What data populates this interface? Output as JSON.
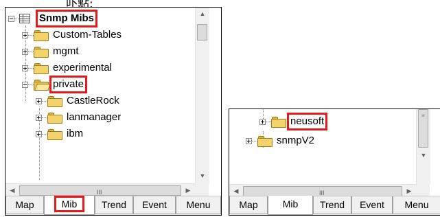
{
  "top_text": "卟點:",
  "left_panel": {
    "tree": [
      {
        "label": "Snmp Mibs",
        "bold": true,
        "icon": "table-icon",
        "expander": "minus",
        "level": 0,
        "highlighted": true
      },
      {
        "label": "Custom-Tables",
        "icon": "folder-icon",
        "expander": "plus",
        "level": 1,
        "highlighted": false
      },
      {
        "label": "mgmt",
        "icon": "folder-icon",
        "expander": "plus",
        "level": 1,
        "highlighted": false
      },
      {
        "label": "experimental",
        "icon": "folder-icon",
        "expander": "plus",
        "level": 1,
        "highlighted": false
      },
      {
        "label": "private",
        "icon": "folder-open-icon",
        "expander": "minus",
        "level": 1,
        "highlighted": true
      },
      {
        "label": "CastleRock",
        "icon": "folder-icon",
        "expander": "plus",
        "level": 2,
        "highlighted": false
      },
      {
        "label": "lanmanager",
        "icon": "folder-icon",
        "expander": "plus",
        "level": 2,
        "highlighted": false
      },
      {
        "label": "ibm",
        "icon": "folder-icon",
        "expander": "plus",
        "level": 2,
        "highlighted": false
      }
    ],
    "tabs": [
      {
        "label": "Map",
        "active": false,
        "highlighted": false
      },
      {
        "label": "Mib",
        "active": true,
        "highlighted": true
      },
      {
        "label": "Trend",
        "active": false,
        "highlighted": false
      },
      {
        "label": "Event",
        "active": false,
        "highlighted": false
      },
      {
        "label": "Menu",
        "active": false,
        "highlighted": false
      }
    ],
    "hscroll_grip": "III"
  },
  "right_panel": {
    "tree": [
      {
        "label": "neusoft",
        "icon": "folder-icon",
        "expander": "plus",
        "level": 2,
        "highlighted": true
      },
      {
        "label": "snmpV2",
        "icon": "folder-icon",
        "expander": "plus",
        "level": 1,
        "highlighted": false
      }
    ],
    "tabs": [
      {
        "label": "Map",
        "active": false,
        "highlighted": false
      },
      {
        "label": "Mib",
        "active": true,
        "highlighted": false
      },
      {
        "label": "Trend",
        "active": false,
        "highlighted": false
      },
      {
        "label": "Event",
        "active": false,
        "highlighted": false
      },
      {
        "label": "Menu",
        "active": false,
        "highlighted": false
      }
    ],
    "hscroll_grip": "III"
  },
  "colors": {
    "highlight": "#e8191b",
    "folder": "#f3d36b",
    "tab_bg": "#f0f0f0"
  }
}
